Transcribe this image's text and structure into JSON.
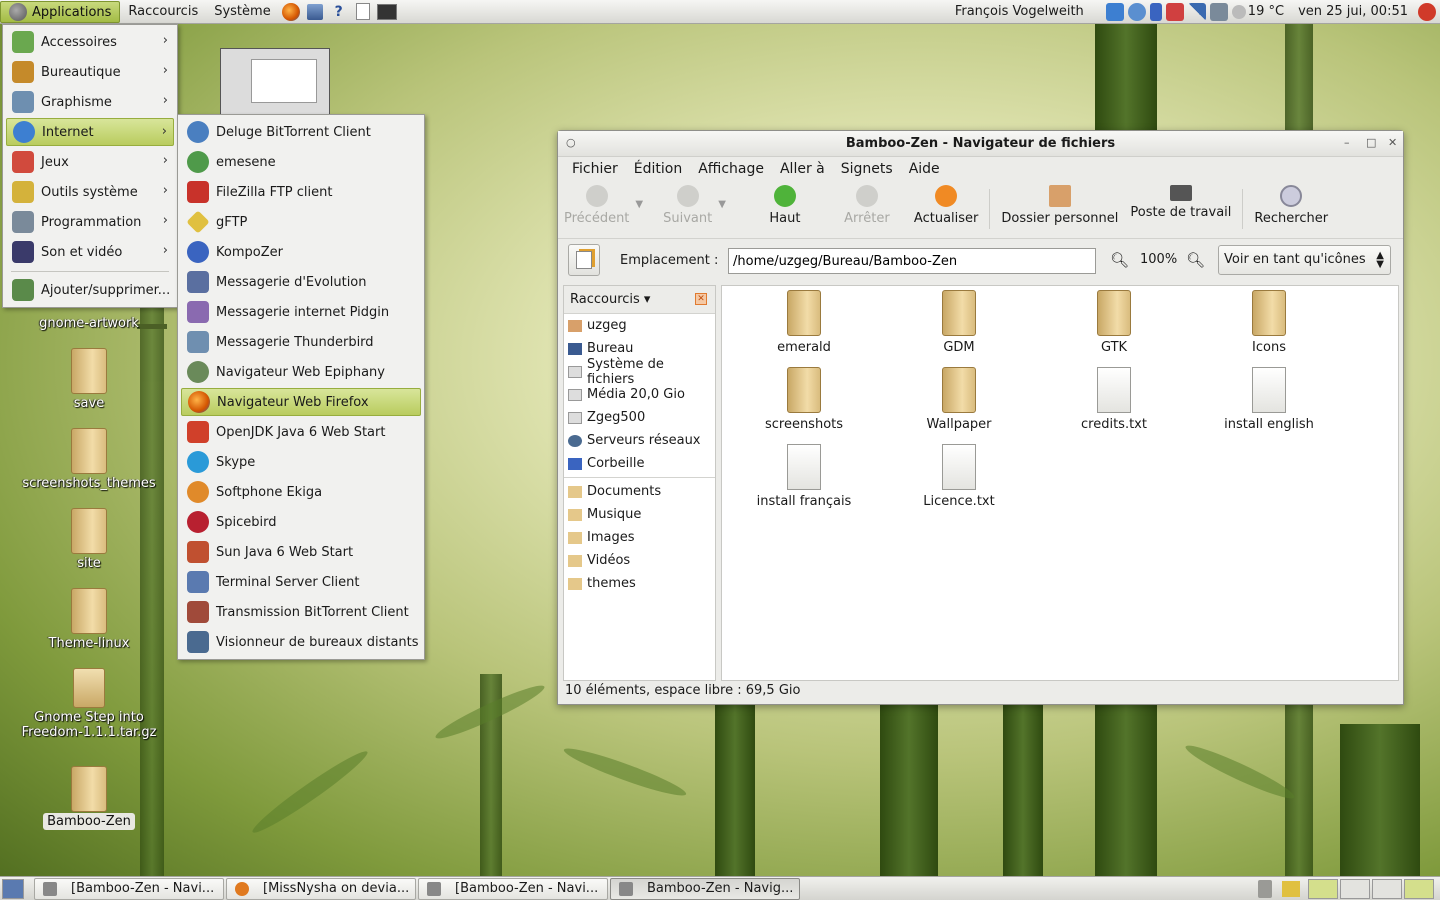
{
  "top_panel": {
    "applications": "Applications",
    "places": "Raccourcis",
    "system": "Système",
    "launchers": [
      "firefox-icon",
      "system-monitor-icon",
      "help-icon",
      "text-editor-icon",
      "terminal-icon"
    ],
    "help_glyph": "?",
    "user": "François Vogelweith",
    "temperature": "19 °C",
    "clock": "ven 25 jui, 00:51"
  },
  "apps_menu": [
    {
      "label": "Accessoires",
      "icon": "accessories-icon",
      "color": "#6aa84f"
    },
    {
      "label": "Bureautique",
      "icon": "office-icon",
      "color": "#c58a2a"
    },
    {
      "label": "Graphisme",
      "icon": "graphics-icon",
      "color": "#6e8fb0"
    },
    {
      "label": "Internet",
      "icon": "internet-icon",
      "color": "#3d7fd1"
    },
    {
      "label": "Jeux",
      "icon": "games-icon",
      "color": "#d14a3d"
    },
    {
      "label": "Outils système",
      "icon": "system-tools-icon",
      "color": "#d4b23b"
    },
    {
      "label": "Programmation",
      "icon": "programming-icon",
      "color": "#7a8a9a"
    },
    {
      "label": "Son et vidéo",
      "icon": "sound-video-icon",
      "color": "#3a3a6a"
    }
  ],
  "apps_menu_extra": "Ajouter/supprimer...",
  "submenu_arrow": "›",
  "internet_menu": [
    {
      "label": "Deluge BitTorrent Client",
      "color": "#4a7fc0"
    },
    {
      "label": "emesene",
      "color": "#4f9a4a"
    },
    {
      "label": "FileZilla FTP client",
      "color": "#c8322a"
    },
    {
      "label": "gFTP",
      "color": "#e0c040"
    },
    {
      "label": "KompoZer",
      "color": "#3a64c0"
    },
    {
      "label": "Messagerie d'Evolution",
      "color": "#5a6fa0"
    },
    {
      "label": "Messagerie internet Pidgin",
      "color": "#8a6ab0"
    },
    {
      "label": "Messagerie Thunderbird",
      "color": "#6f8fb0"
    },
    {
      "label": "Navigateur Web Epiphany",
      "color": "#6a8a5a"
    },
    {
      "label": "Navigateur Web Firefox",
      "color": "#e07a20"
    },
    {
      "label": "OpenJDK Java 6 Web Start",
      "color": "#d0402a"
    },
    {
      "label": "Skype",
      "color": "#2a9ad8"
    },
    {
      "label": "Softphone Ekiga",
      "color": "#e08a2a"
    },
    {
      "label": "Spicebird",
      "color": "#b82030"
    },
    {
      "label": "Sun Java 6 Web Start",
      "color": "#c05030"
    },
    {
      "label": "Terminal Server Client",
      "color": "#5a7ab0"
    },
    {
      "label": "Transmission BitTorrent Client",
      "color": "#a04a3a"
    },
    {
      "label": "Visionneur de bureaux distants",
      "color": "#4a6a90"
    }
  ],
  "desktop_icons": [
    "gnome-artwork",
    "save",
    "screenshots_themes",
    "site",
    "Theme-linux",
    "Gnome Step into Freedom-1.1.1.tar.gz",
    "Bamboo-Zen"
  ],
  "window": {
    "title": "Bamboo-Zen - Navigateur de fichiers",
    "menubar": [
      "Fichier",
      "Édition",
      "Affichage",
      "Aller à",
      "Signets",
      "Aide"
    ],
    "toolbar": {
      "back": "Précédent",
      "forward": "Suivant",
      "up": "Haut",
      "stop": "Arrêter",
      "reload": "Actualiser",
      "home": "Dossier personnel",
      "computer": "Poste de travail",
      "search": "Rechercher"
    },
    "location_label": "Emplacement :",
    "location_value": "/home/uzgeg/Bureau/Bamboo-Zen",
    "zoom": "100%",
    "view_mode": "Voir en tant qu'icônes",
    "sidebar_title": "Raccourcis",
    "sidebar_places": [
      "uzgeg",
      "Bureau",
      "Système de fichiers",
      "Média 20,0 Gio",
      "Zgeg500",
      "Serveurs réseaux",
      "Corbeille"
    ],
    "sidebar_bookmarks": [
      "Documents",
      "Musique",
      "Images",
      "Vidéos",
      "themes"
    ],
    "files": [
      {
        "name": "emerald",
        "type": "folder"
      },
      {
        "name": "GDM",
        "type": "folder"
      },
      {
        "name": "GTK",
        "type": "folder"
      },
      {
        "name": "Icons",
        "type": "folder"
      },
      {
        "name": "screenshots",
        "type": "folder"
      },
      {
        "name": "Wallpaper",
        "type": "folder"
      },
      {
        "name": "credits.txt",
        "type": "file"
      },
      {
        "name": "install english",
        "type": "file"
      },
      {
        "name": "install français",
        "type": "file"
      },
      {
        "name": "Licence.txt",
        "type": "file"
      }
    ],
    "status": "10 éléments, espace libre : 69,5 Gio"
  },
  "taskbar": [
    {
      "label": "[Bamboo-Zen - Navi...",
      "active": false
    },
    {
      "label": "[MissNysha on devia...",
      "active": false
    },
    {
      "label": "[Bamboo-Zen - Navi...",
      "active": false
    },
    {
      "label": "Bamboo-Zen - Navig...",
      "active": true
    }
  ],
  "colors": {
    "accent": "#b9cc5e",
    "panel": "#e5e5e1"
  }
}
